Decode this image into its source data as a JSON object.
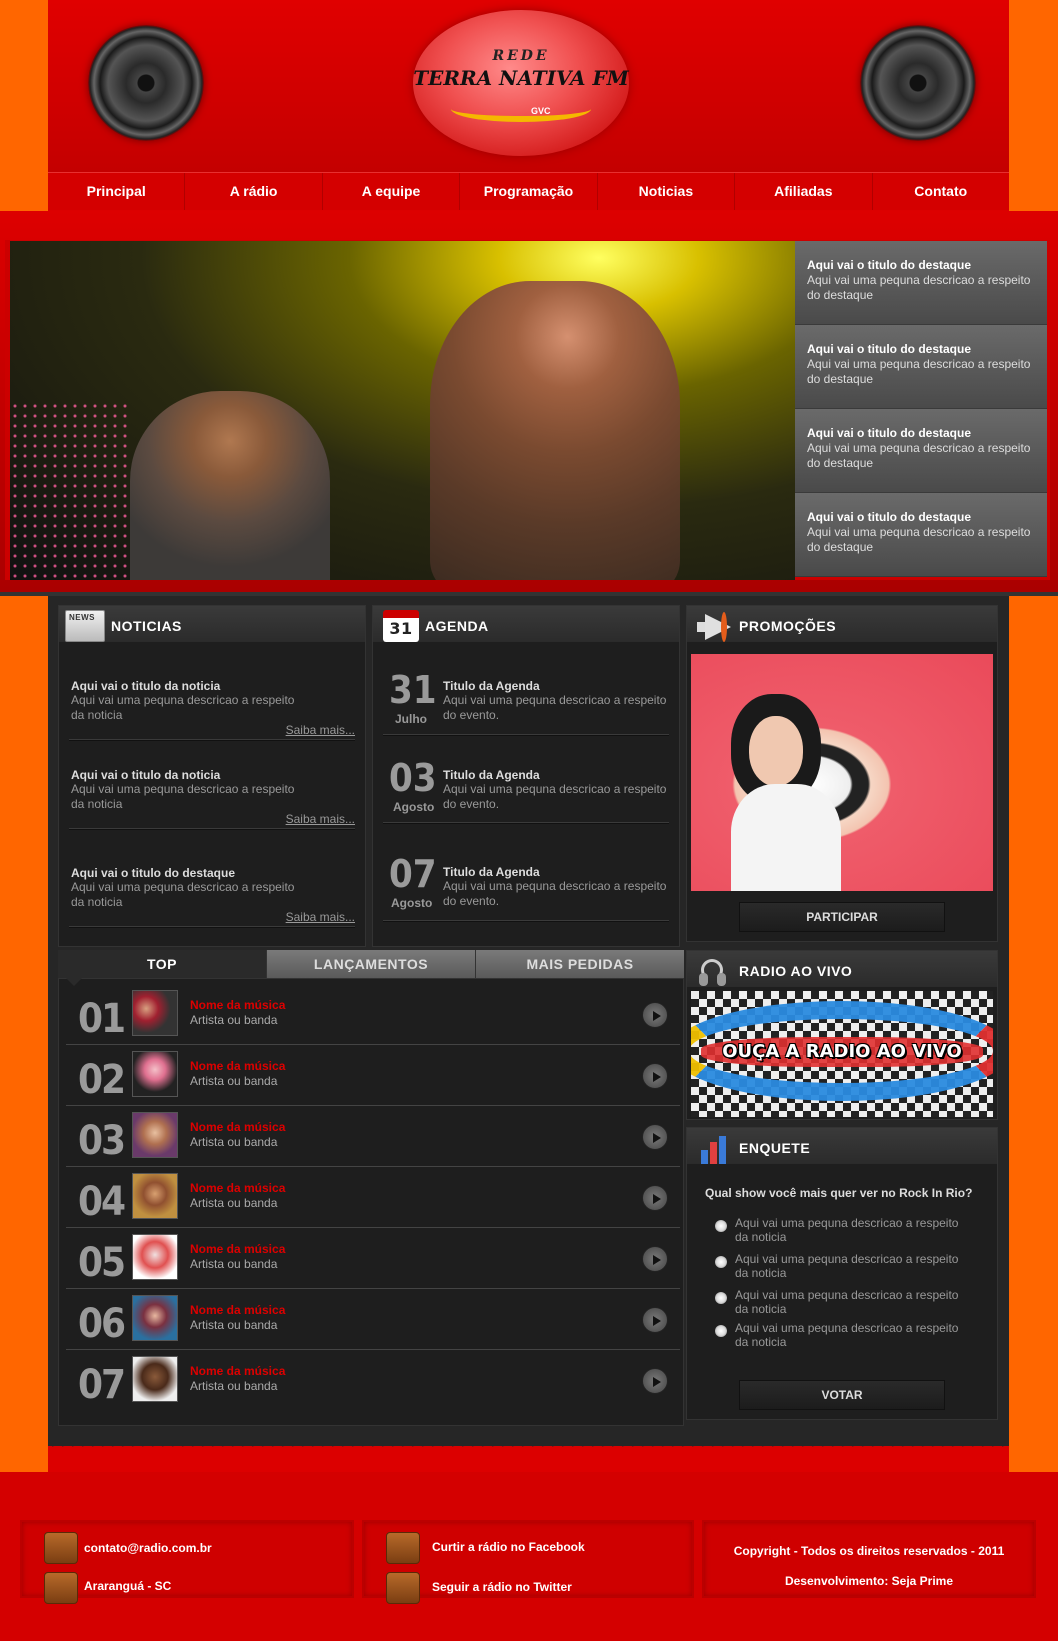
{
  "header": {
    "logo": {
      "top": "REDE",
      "name": "TERRA NATIVA FM",
      "sub": "GVC"
    }
  },
  "nav": [
    "Principal",
    "A rádio",
    "A equipe",
    "Programação",
    "Noticias",
    "Afiliadas",
    "Contato"
  ],
  "slider": {
    "features": [
      {
        "title": "Aqui vai o titulo do destaque",
        "desc": "Aqui vai uma pequna descricao a respeito do destaque"
      },
      {
        "title": "Aqui vai o titulo do destaque",
        "desc": "Aqui vai uma pequna descricao a respeito do destaque"
      },
      {
        "title": "Aqui vai o titulo do destaque",
        "desc": "Aqui vai uma pequna descricao a respeito do destaque"
      },
      {
        "title": "Aqui vai o titulo do destaque",
        "desc": "Aqui vai uma pequna descricao a respeito do destaque"
      }
    ]
  },
  "noticias": {
    "heading": "NOTICIAS",
    "icon_label": "NEWS",
    "items": [
      {
        "title": "Aqui vai o titulo da noticia",
        "desc": "Aqui vai uma pequna descricao a respeito da noticia",
        "more": "Saiba mais..."
      },
      {
        "title": "Aqui vai o titulo da noticia",
        "desc": "Aqui vai uma pequna descricao a respeito da noticia",
        "more": "Saiba mais..."
      },
      {
        "title": "Aqui vai o titulo do destaque",
        "desc": "Aqui vai uma pequna descricao a respeito da noticia",
        "more": "Saiba mais..."
      }
    ]
  },
  "agenda": {
    "heading": "AGENDA",
    "icon_day": "31",
    "items": [
      {
        "day": "31",
        "month": "Julho",
        "title": "Titulo da Agenda",
        "desc": "Aqui vai uma pequna descricao a respeito do evento."
      },
      {
        "day": "03",
        "month": "Agosto",
        "title": "Titulo da Agenda",
        "desc": "Aqui vai uma pequna descricao a respeito do evento."
      },
      {
        "day": "07",
        "month": "Agosto",
        "title": "Titulo da Agenda",
        "desc": "Aqui vai uma pequna descricao a respeito do evento."
      }
    ]
  },
  "promocoes": {
    "heading": "PROMOÇÕES",
    "button": "PARTICIPAR"
  },
  "top": {
    "tabs": [
      "TOP",
      "LANÇAMENTOS",
      "MAIS PEDIDAS"
    ],
    "rows": [
      {
        "rank": "01",
        "song": "Nome da música",
        "artist": "Artista ou banda"
      },
      {
        "rank": "02",
        "song": "Nome da música",
        "artist": "Artista ou banda"
      },
      {
        "rank": "03",
        "song": "Nome da música",
        "artist": "Artista ou banda"
      },
      {
        "rank": "04",
        "song": "Nome da música",
        "artist": "Artista ou banda"
      },
      {
        "rank": "05",
        "song": "Nome da música",
        "artist": "Artista ou banda"
      },
      {
        "rank": "06",
        "song": "Nome da música",
        "artist": "Artista ou banda"
      },
      {
        "rank": "07",
        "song": "Nome da música",
        "artist": "Artista ou banda"
      }
    ]
  },
  "radio": {
    "heading": "RADIO AO VIVO",
    "banner": "OUÇA A RADIO AO VIVO"
  },
  "enquete": {
    "heading": "ENQUETE",
    "question": "Qual show você mais quer ver no Rock In Rio?",
    "options": [
      "Aqui vai uma pequna descricao a respeito da noticia",
      "Aqui vai uma pequna descricao a respeito da noticia",
      "Aqui vai uma pequna descricao a respeito da noticia",
      "Aqui vai uma pequna descricao a respeito da noticia"
    ],
    "button": "VOTAR"
  },
  "footer": {
    "email": "contato@radio.com.br",
    "city": "Araranguá - SC",
    "facebook": "Curtir a rádio no Facebook",
    "twitter": "Seguir a rádio no Twitter",
    "copyright": "Copyright - Todos os direitos reservados - 2011",
    "dev": "Desenvolvimento: Seja Prime"
  }
}
